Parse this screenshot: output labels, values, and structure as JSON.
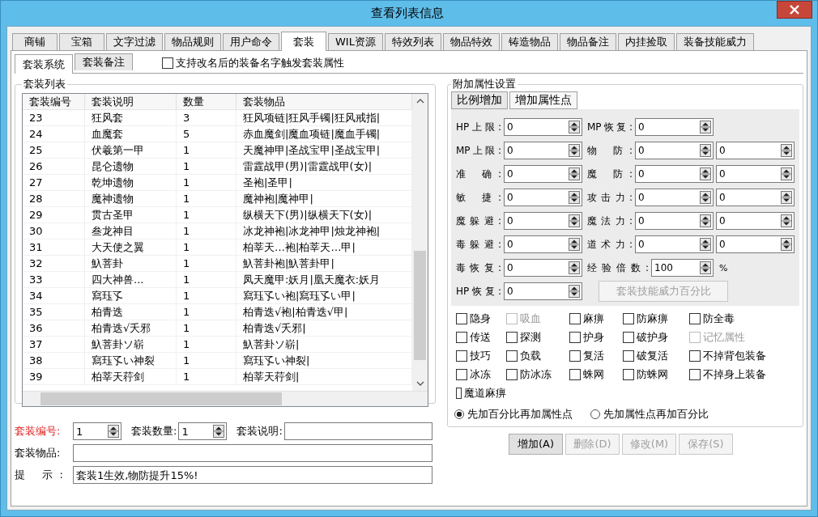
{
  "window": {
    "title": "查看列表信息"
  },
  "tabs": [
    {
      "label": "商铺",
      "selected": false
    },
    {
      "label": "宝箱",
      "selected": false
    },
    {
      "label": "文字过滤",
      "selected": false
    },
    {
      "label": "物品规则",
      "selected": false
    },
    {
      "label": "用户命令",
      "selected": false
    },
    {
      "label": "套装",
      "selected": true
    },
    {
      "label": "WIL资源",
      "selected": false
    },
    {
      "label": "特效列表",
      "selected": false
    },
    {
      "label": "物品特效",
      "selected": false
    },
    {
      "label": "铸造物品",
      "selected": false
    },
    {
      "label": "物品备注",
      "selected": false
    },
    {
      "label": "内挂捡取",
      "selected": false
    },
    {
      "label": "装备技能威力",
      "selected": false
    }
  ],
  "subtabs": [
    {
      "label": "套装系统",
      "selected": true
    },
    {
      "label": "套装备注",
      "selected": false
    }
  ],
  "rename_option": {
    "label": "支持改名后的装备名字触发套装属性",
    "checked": false
  },
  "suit_list": {
    "title": "套装列表",
    "columns": [
      "套装编号",
      "套装说明",
      "数量",
      "套装物品"
    ],
    "rows": [
      [
        "23",
        "狂风套",
        "3",
        "狂风项链|狂风手镯|狂风戒指|"
      ],
      [
        "24",
        "血魔套",
        "5",
        "赤血魔剑|魔血项链|魔血手镯|"
      ],
      [
        "25",
        "伏羲第一甲",
        "1",
        "天魔神甲|圣战宝甲|圣战宝甲|"
      ],
      [
        "26",
        "昆仑遗物",
        "1",
        "雷霆战甲(男)|雷霆战甲(女)|"
      ],
      [
        "27",
        "乾坤遗物",
        "1",
        "圣袍|圣甲|"
      ],
      [
        "28",
        "魔神遗物",
        "1",
        "魔神袍|魔神甲|"
      ],
      [
        "29",
        "贯古圣甲",
        "1",
        "纵横天下(男)|纵横天下(女)|"
      ],
      [
        "30",
        "叁龙神目",
        "1",
        "冰龙神袍|冰龙神甲|烛龙神袍|"
      ],
      [
        "31",
        "大天使之翼",
        "1",
        "柏莘天…袍|柏莘天…甲|"
      ],
      [
        "32",
        "魞菩卦",
        "1",
        "魞菩卦袍|魞菩卦甲|"
      ],
      [
        "33",
        "四大神兽...",
        "1",
        "凤天魔甲:妖月|凰天魔衣:妖月"
      ],
      [
        "34",
        "寫珏孓",
        "1",
        "寫珏孓い袍|寫珏孓い甲|"
      ],
      [
        "35",
        "柏青迭",
        "1",
        "柏青迭√袍|柏青迭√甲|"
      ],
      [
        "36",
        "柏青迭√夭邪",
        "1",
        "柏青迭√夭邪|"
      ],
      [
        "37",
        "魞菩卦ソ崭",
        "1",
        "魞菩卦ソ崭|"
      ],
      [
        "38",
        "寫珏孓い神裂",
        "1",
        "寫珏孓い神裂|"
      ],
      [
        "39",
        "柏莘天荇剑",
        "1",
        "柏莘天荇剑|"
      ]
    ]
  },
  "suit_form": {
    "id_label": "套装编号:",
    "id_value": "1",
    "count_label": "套装数量:",
    "count_value": "1",
    "desc_label": "套装说明:",
    "items_label": "套装物品:",
    "hint_label": "提 示:",
    "hint_value": "套装1生效,物防提升15%!"
  },
  "attr_group": {
    "title": "附加属性设置",
    "tabs": [
      {
        "label": "比例增加",
        "selected": false
      },
      {
        "label": "增加属性点",
        "selected": true
      }
    ]
  },
  "attributes_left": [
    {
      "label": "HP上限:",
      "value": "0"
    },
    {
      "label": "MP上限:",
      "value": "0"
    },
    {
      "label": "准 确:",
      "value": "0"
    },
    {
      "label": "敏 捷:",
      "value": "0"
    },
    {
      "label": "魔躲避:",
      "value": "0"
    },
    {
      "label": "毒躲避:",
      "value": "0"
    },
    {
      "label": "毒恢复:",
      "value": "0"
    },
    {
      "label": "HP恢复:",
      "value": "0"
    }
  ],
  "attributes_right": [
    {
      "label": "MP恢复:",
      "values": [
        "0"
      ]
    },
    {
      "label": "物 防:",
      "values": [
        "0",
        "0"
      ]
    },
    {
      "label": "魔 防:",
      "values": [
        "0",
        "0"
      ]
    },
    {
      "label": "攻击力:",
      "values": [
        "0",
        "0"
      ]
    },
    {
      "label": "魔法力:",
      "values": [
        "0",
        "0"
      ]
    },
    {
      "label": "道术力:",
      "values": [
        "0",
        "0"
      ]
    },
    {
      "label": "经验倍数:",
      "values": [
        "100"
      ],
      "unit": "%"
    }
  ],
  "skill_power_button": {
    "label": "套装技能威力百分比",
    "disabled": true
  },
  "flags": [
    {
      "label": "隐身",
      "checked": false,
      "disabled": false
    },
    {
      "label": "吸血",
      "checked": false,
      "disabled": true
    },
    {
      "label": "麻痹",
      "checked": false,
      "disabled": false
    },
    {
      "label": "防麻痹",
      "checked": false,
      "disabled": false
    },
    {
      "label": "防全毒",
      "checked": false,
      "disabled": false
    },
    {
      "label": "传送",
      "checked": false,
      "disabled": false
    },
    {
      "label": "探测",
      "checked": false,
      "disabled": false
    },
    {
      "label": "护身",
      "checked": false,
      "disabled": false
    },
    {
      "label": "破护身",
      "checked": false,
      "disabled": false
    },
    {
      "label": "记忆属性",
      "checked": false,
      "disabled": true
    },
    {
      "label": "技巧",
      "checked": false,
      "disabled": false
    },
    {
      "label": "负载",
      "checked": false,
      "disabled": false
    },
    {
      "label": "复活",
      "checked": false,
      "disabled": false
    },
    {
      "label": "破复活",
      "checked": false,
      "disabled": false
    },
    {
      "label": "不掉背包装备",
      "checked": false,
      "disabled": false
    },
    {
      "label": "冰冻",
      "checked": false,
      "disabled": false
    },
    {
      "label": "防冰冻",
      "checked": false,
      "disabled": false
    },
    {
      "label": "蛛网",
      "checked": false,
      "disabled": false
    },
    {
      "label": "防蛛网",
      "checked": false,
      "disabled": false
    },
    {
      "label": "不掉身上装备",
      "checked": false,
      "disabled": false
    },
    {
      "label": "魔道麻痹",
      "checked": false,
      "disabled": false
    }
  ],
  "order_options": [
    {
      "label": "先加百分比再加属性点",
      "selected": true
    },
    {
      "label": "先加属性点再加百分比",
      "selected": false
    }
  ],
  "actions": [
    {
      "label": "增加(A)",
      "disabled": false
    },
    {
      "label": "删除(D)",
      "disabled": true
    },
    {
      "label": "修改(M)",
      "disabled": true
    },
    {
      "label": "保存(S)",
      "disabled": true
    }
  ]
}
